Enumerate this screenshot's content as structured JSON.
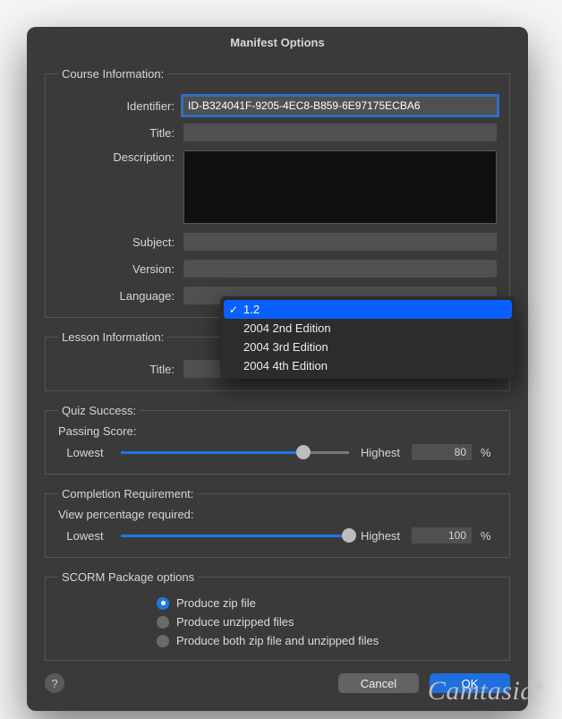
{
  "window_title": "Manifest Options",
  "course": {
    "section": "Course Information:",
    "identifier_label": "Identifier:",
    "identifier_value": "ID-B324041F-9205-4EC8-B859-6E97175ECBA6",
    "title_label": "Title:",
    "title_value": "",
    "description_label": "Description:",
    "subject_label": "Subject:",
    "subject_value": "",
    "version_label": "Version:",
    "language_label": "Language:"
  },
  "version_dropdown": {
    "selected": "1.2",
    "options": [
      "1.2",
      "2004 2nd Edition",
      "2004 3rd Edition",
      "2004 4th Edition"
    ]
  },
  "lesson": {
    "section": "Lesson Information:",
    "title_label": "Title:",
    "title_value": ""
  },
  "quiz": {
    "section": "Quiz Success:",
    "passing_label": "Passing Score:",
    "lowest": "Lowest",
    "highest": "Highest",
    "value": "80",
    "pct": "%",
    "slider_pct": 80
  },
  "completion": {
    "section": "Completion Requirement:",
    "view_label": "View percentage required:",
    "lowest": "Lowest",
    "highest": "Highest",
    "value": "100",
    "pct": "%",
    "slider_pct": 100
  },
  "scorm": {
    "section": "SCORM Package options",
    "options": [
      "Produce zip file",
      "Produce unzipped files",
      "Produce both zip file and unzipped files"
    ],
    "selected_index": 0
  },
  "buttons": {
    "cancel": "Cancel",
    "ok": "OK",
    "help": "?"
  },
  "watermark": "Camtasia"
}
